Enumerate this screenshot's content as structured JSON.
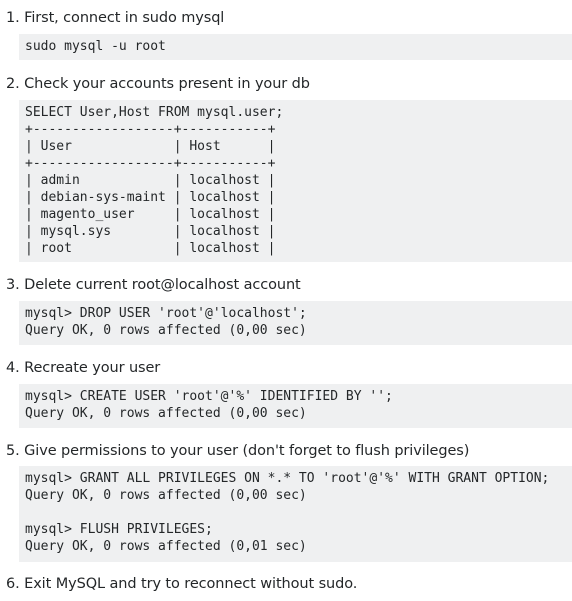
{
  "steps": [
    {
      "title": "1. First, connect in sudo mysql",
      "code": "sudo mysql -u root"
    },
    {
      "title": "2. Check your accounts present in your db",
      "code": "SELECT User,Host FROM mysql.user;\n+------------------+-----------+\n| User             | Host      |\n+------------------+-----------+\n| admin            | localhost |\n| debian-sys-maint | localhost |\n| magento_user     | localhost |\n| mysql.sys        | localhost |\n| root             | localhost |"
    },
    {
      "title": "3. Delete current root@localhost account",
      "code": "mysql> DROP USER 'root'@'localhost';\nQuery OK, 0 rows affected (0,00 sec)"
    },
    {
      "title": "4. Recreate your user",
      "code": "mysql> CREATE USER 'root'@'%' IDENTIFIED BY '';\nQuery OK, 0 rows affected (0,00 sec)"
    },
    {
      "title": "5. Give permissions to your user (don't forget to flush privileges)",
      "code": "mysql> GRANT ALL PRIVILEGES ON *.* TO 'root'@'%' WITH GRANT OPTION;\nQuery OK, 0 rows affected (0,00 sec)\n\nmysql> FLUSH PRIVILEGES;\nQuery OK, 0 rows affected (0,01 sec)"
    },
    {
      "title": "6. Exit MySQL and try to reconnect without sudo."
    }
  ]
}
